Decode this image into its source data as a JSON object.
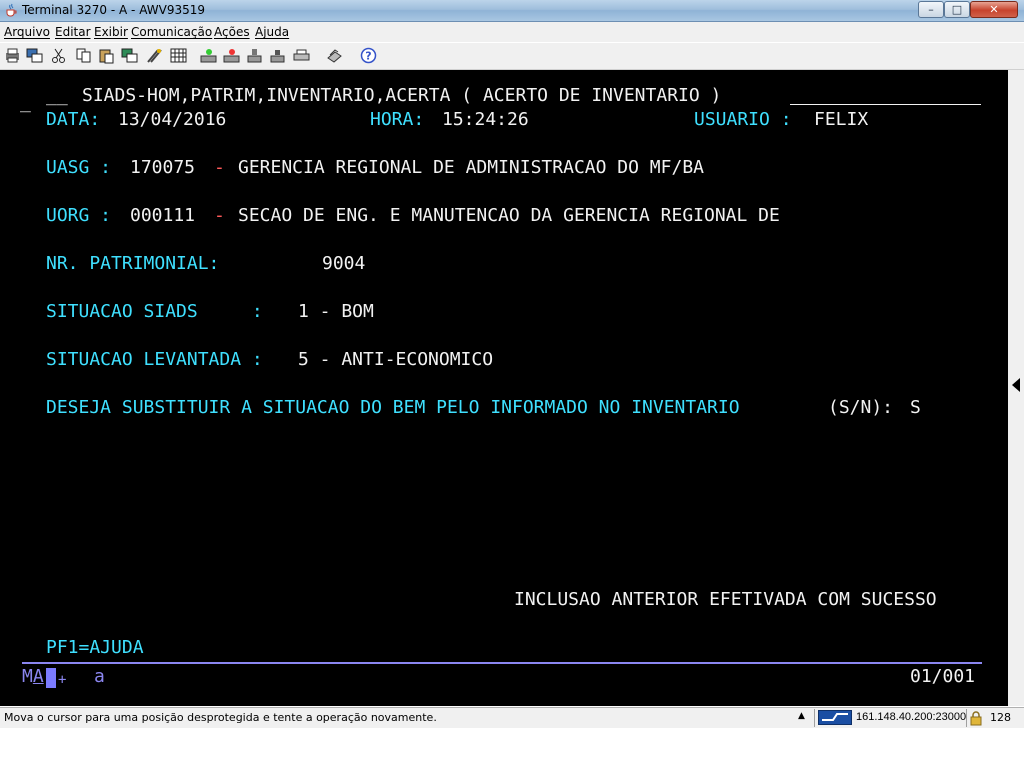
{
  "window": {
    "title": "Terminal 3270 - A - AWV93519",
    "app_icon": "java-cup-icon",
    "controls": {
      "minimize": "–",
      "maximize": "□",
      "close": "✕"
    }
  },
  "menu": [
    "Arquivo",
    "Editar",
    "Exibir",
    "Comunicação",
    "Ações",
    "Ajuda"
  ],
  "toolbar": {
    "icons": [
      "print-screen-icon",
      "copy-screen-icon",
      "cut-icon",
      "copy-icon",
      "paste-icon",
      "paste-special-icon",
      "macro-icon",
      "keypad-icon",
      "connect-icon",
      "disconnect-icon",
      "send-file-icon",
      "receive-file-icon",
      "printer-icon",
      "color-map-icon",
      "help-icon"
    ]
  },
  "terminal": {
    "cmd_prefix": "_",
    "cmd_field": "__",
    "header": "SIADS-HOM,PATRIM,INVENTARIO,ACERTA ( ACERTO DE INVENTARIO )",
    "data_label": "DATA:",
    "data_value": "13/04/2016",
    "hora_label": "HORA:",
    "hora_value": "15:24:26",
    "usuario_label": "USUARIO :",
    "usuario_value": "FELIX",
    "uasg_label": "UASG :",
    "uasg_code": "170075",
    "uasg_dash": "-",
    "uasg_name": "GERENCIA REGIONAL DE ADMINISTRACAO DO MF/BA",
    "uorg_label": "UORG :",
    "uorg_code": "000111",
    "uorg_dash": "-",
    "uorg_name": "SECAO DE ENG. E MANUTENCAO DA GERENCIA REGIONAL DE",
    "patrimonial_label": "NR. PATRIMONIAL:",
    "patrimonial_value": "9004",
    "sit_siads_label": "SITUACAO SIADS     :",
    "sit_siads_value": "1 - BOM",
    "sit_lev_label": "SITUACAO LEVANTADA :",
    "sit_lev_value": "5 - ANTI-ECONOMICO",
    "question_label": "DESEJA SUBSTITUIR A SITUACAO DO BEM PELO INFORMADO NO INVENTARIO",
    "question_options": "(S/N):",
    "question_answer": "S",
    "message": "INCLUSAO ANTERIOR EFETIVADA COM SUCESSO",
    "pf_keys": "PF1=AJUDA"
  },
  "oia": {
    "mode_prefix": "M",
    "mode_cursor": "A",
    "plus": "+",
    "input_mode": "a",
    "cursor_pos": "01/001"
  },
  "status": {
    "message": "Mova o cursor para uma posição desprotegida e tente a operação novamente.",
    "host": "161.148.40.200:23000",
    "cipher": "128"
  },
  "colors": {
    "terminal_bg": "#000000",
    "field_label": "#3fe0ff",
    "field_value": "#f2f2f2",
    "separator": "#ff5a5a",
    "oia_line": "#8b86f0"
  }
}
